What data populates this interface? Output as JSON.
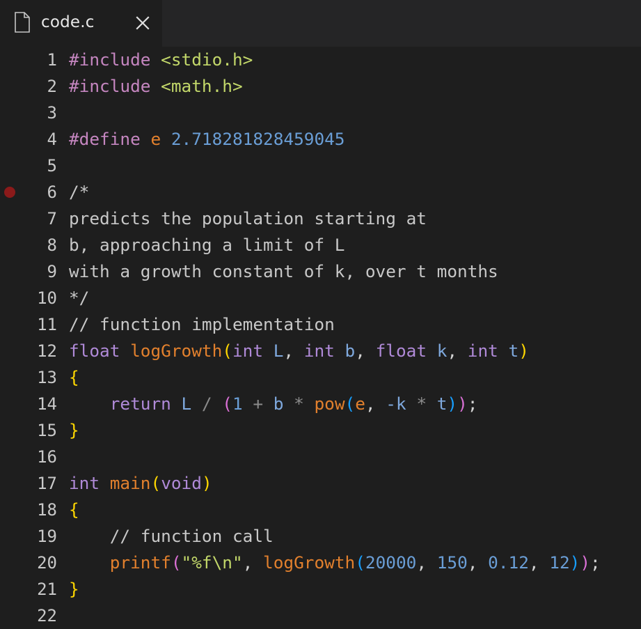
{
  "tab": {
    "title": "code.c",
    "close_label": "×"
  },
  "lines": [
    {
      "n": "1",
      "tokens": [
        {
          "t": "#include",
          "c": "kw-pp"
        },
        {
          "t": " ",
          "c": "pl"
        },
        {
          "t": "<stdio.h>",
          "c": "str"
        }
      ]
    },
    {
      "n": "2",
      "tokens": [
        {
          "t": "#include",
          "c": "kw-pp"
        },
        {
          "t": " ",
          "c": "pl"
        },
        {
          "t": "<math.h>",
          "c": "str"
        }
      ]
    },
    {
      "n": "3",
      "tokens": []
    },
    {
      "n": "4",
      "tokens": [
        {
          "t": "#define",
          "c": "kw-pp"
        },
        {
          "t": " ",
          "c": "pl"
        },
        {
          "t": "e",
          "c": "mac"
        },
        {
          "t": " ",
          "c": "pl"
        },
        {
          "t": "2.718281828459045",
          "c": "num"
        }
      ]
    },
    {
      "n": "5",
      "tokens": []
    },
    {
      "n": "6",
      "breakpoint": true,
      "tokens": [
        {
          "t": "/*",
          "c": "cmt"
        }
      ]
    },
    {
      "n": "7",
      "tokens": [
        {
          "t": "predicts the population starting at",
          "c": "cmt"
        }
      ]
    },
    {
      "n": "8",
      "tokens": [
        {
          "t": "b, approaching a limit of L",
          "c": "cmt"
        }
      ]
    },
    {
      "n": "9",
      "tokens": [
        {
          "t": "with a growth constant of k, over t months",
          "c": "cmt"
        }
      ]
    },
    {
      "n": "10",
      "tokens": [
        {
          "t": "*/",
          "c": "cmt"
        }
      ]
    },
    {
      "n": "11",
      "tokens": [
        {
          "t": "// function implementation",
          "c": "cmt"
        }
      ]
    },
    {
      "n": "12",
      "tokens": [
        {
          "t": "float",
          "c": "typ"
        },
        {
          "t": " ",
          "c": "pl"
        },
        {
          "t": "logGrowth",
          "c": "fn"
        },
        {
          "t": "(",
          "c": "br-y"
        },
        {
          "t": "int",
          "c": "typ"
        },
        {
          "t": " ",
          "c": "pl"
        },
        {
          "t": "L",
          "c": "var"
        },
        {
          "t": ", ",
          "c": "pl"
        },
        {
          "t": "int",
          "c": "typ"
        },
        {
          "t": " ",
          "c": "pl"
        },
        {
          "t": "b",
          "c": "var"
        },
        {
          "t": ", ",
          "c": "pl"
        },
        {
          "t": "float",
          "c": "typ"
        },
        {
          "t": " ",
          "c": "pl"
        },
        {
          "t": "k",
          "c": "var"
        },
        {
          "t": ", ",
          "c": "pl"
        },
        {
          "t": "int",
          "c": "typ"
        },
        {
          "t": " ",
          "c": "pl"
        },
        {
          "t": "t",
          "c": "var"
        },
        {
          "t": ")",
          "c": "br-y"
        }
      ]
    },
    {
      "n": "13",
      "tokens": [
        {
          "t": "{",
          "c": "br-y"
        }
      ]
    },
    {
      "n": "14",
      "tokens": [
        {
          "t": "    ",
          "c": "pl"
        },
        {
          "t": "return",
          "c": "typ"
        },
        {
          "t": " ",
          "c": "pl"
        },
        {
          "t": "L",
          "c": "var"
        },
        {
          "t": " / ",
          "c": "op"
        },
        {
          "t": "(",
          "c": "br-p"
        },
        {
          "t": "1",
          "c": "num"
        },
        {
          "t": " + ",
          "c": "op"
        },
        {
          "t": "b",
          "c": "var"
        },
        {
          "t": " * ",
          "c": "op"
        },
        {
          "t": "pow",
          "c": "fn"
        },
        {
          "t": "(",
          "c": "br-b"
        },
        {
          "t": "e",
          "c": "mac"
        },
        {
          "t": ", ",
          "c": "pl"
        },
        {
          "t": "-k",
          "c": "var"
        },
        {
          "t": " * ",
          "c": "op"
        },
        {
          "t": "t",
          "c": "var"
        },
        {
          "t": ")",
          "c": "br-b"
        },
        {
          "t": ")",
          "c": "br-p"
        },
        {
          "t": ";",
          "c": "pl"
        }
      ]
    },
    {
      "n": "15",
      "tokens": [
        {
          "t": "}",
          "c": "br-y"
        }
      ]
    },
    {
      "n": "16",
      "tokens": []
    },
    {
      "n": "17",
      "tokens": [
        {
          "t": "int",
          "c": "typ"
        },
        {
          "t": " ",
          "c": "pl"
        },
        {
          "t": "main",
          "c": "fn"
        },
        {
          "t": "(",
          "c": "br-y"
        },
        {
          "t": "void",
          "c": "typ"
        },
        {
          "t": ")",
          "c": "br-y"
        }
      ]
    },
    {
      "n": "18",
      "tokens": [
        {
          "t": "{",
          "c": "br-y"
        }
      ]
    },
    {
      "n": "19",
      "tokens": [
        {
          "t": "    ",
          "c": "pl"
        },
        {
          "t": "// function call",
          "c": "cmt"
        }
      ]
    },
    {
      "n": "20",
      "tokens": [
        {
          "t": "    ",
          "c": "pl"
        },
        {
          "t": "printf",
          "c": "fn"
        },
        {
          "t": "(",
          "c": "br-p"
        },
        {
          "t": "\"%f\\n\"",
          "c": "str"
        },
        {
          "t": ", ",
          "c": "pl"
        },
        {
          "t": "logGrowth",
          "c": "fn"
        },
        {
          "t": "(",
          "c": "br-b"
        },
        {
          "t": "20000",
          "c": "num"
        },
        {
          "t": ", ",
          "c": "pl"
        },
        {
          "t": "150",
          "c": "num"
        },
        {
          "t": ", ",
          "c": "pl"
        },
        {
          "t": "0.12",
          "c": "num"
        },
        {
          "t": ", ",
          "c": "pl"
        },
        {
          "t": "12",
          "c": "num"
        },
        {
          "t": ")",
          "c": "br-b"
        },
        {
          "t": ")",
          "c": "br-p"
        },
        {
          "t": ";",
          "c": "pl"
        }
      ]
    },
    {
      "n": "21",
      "tokens": [
        {
          "t": "}",
          "c": "br-y"
        }
      ]
    },
    {
      "n": "22",
      "tokens": []
    }
  ]
}
